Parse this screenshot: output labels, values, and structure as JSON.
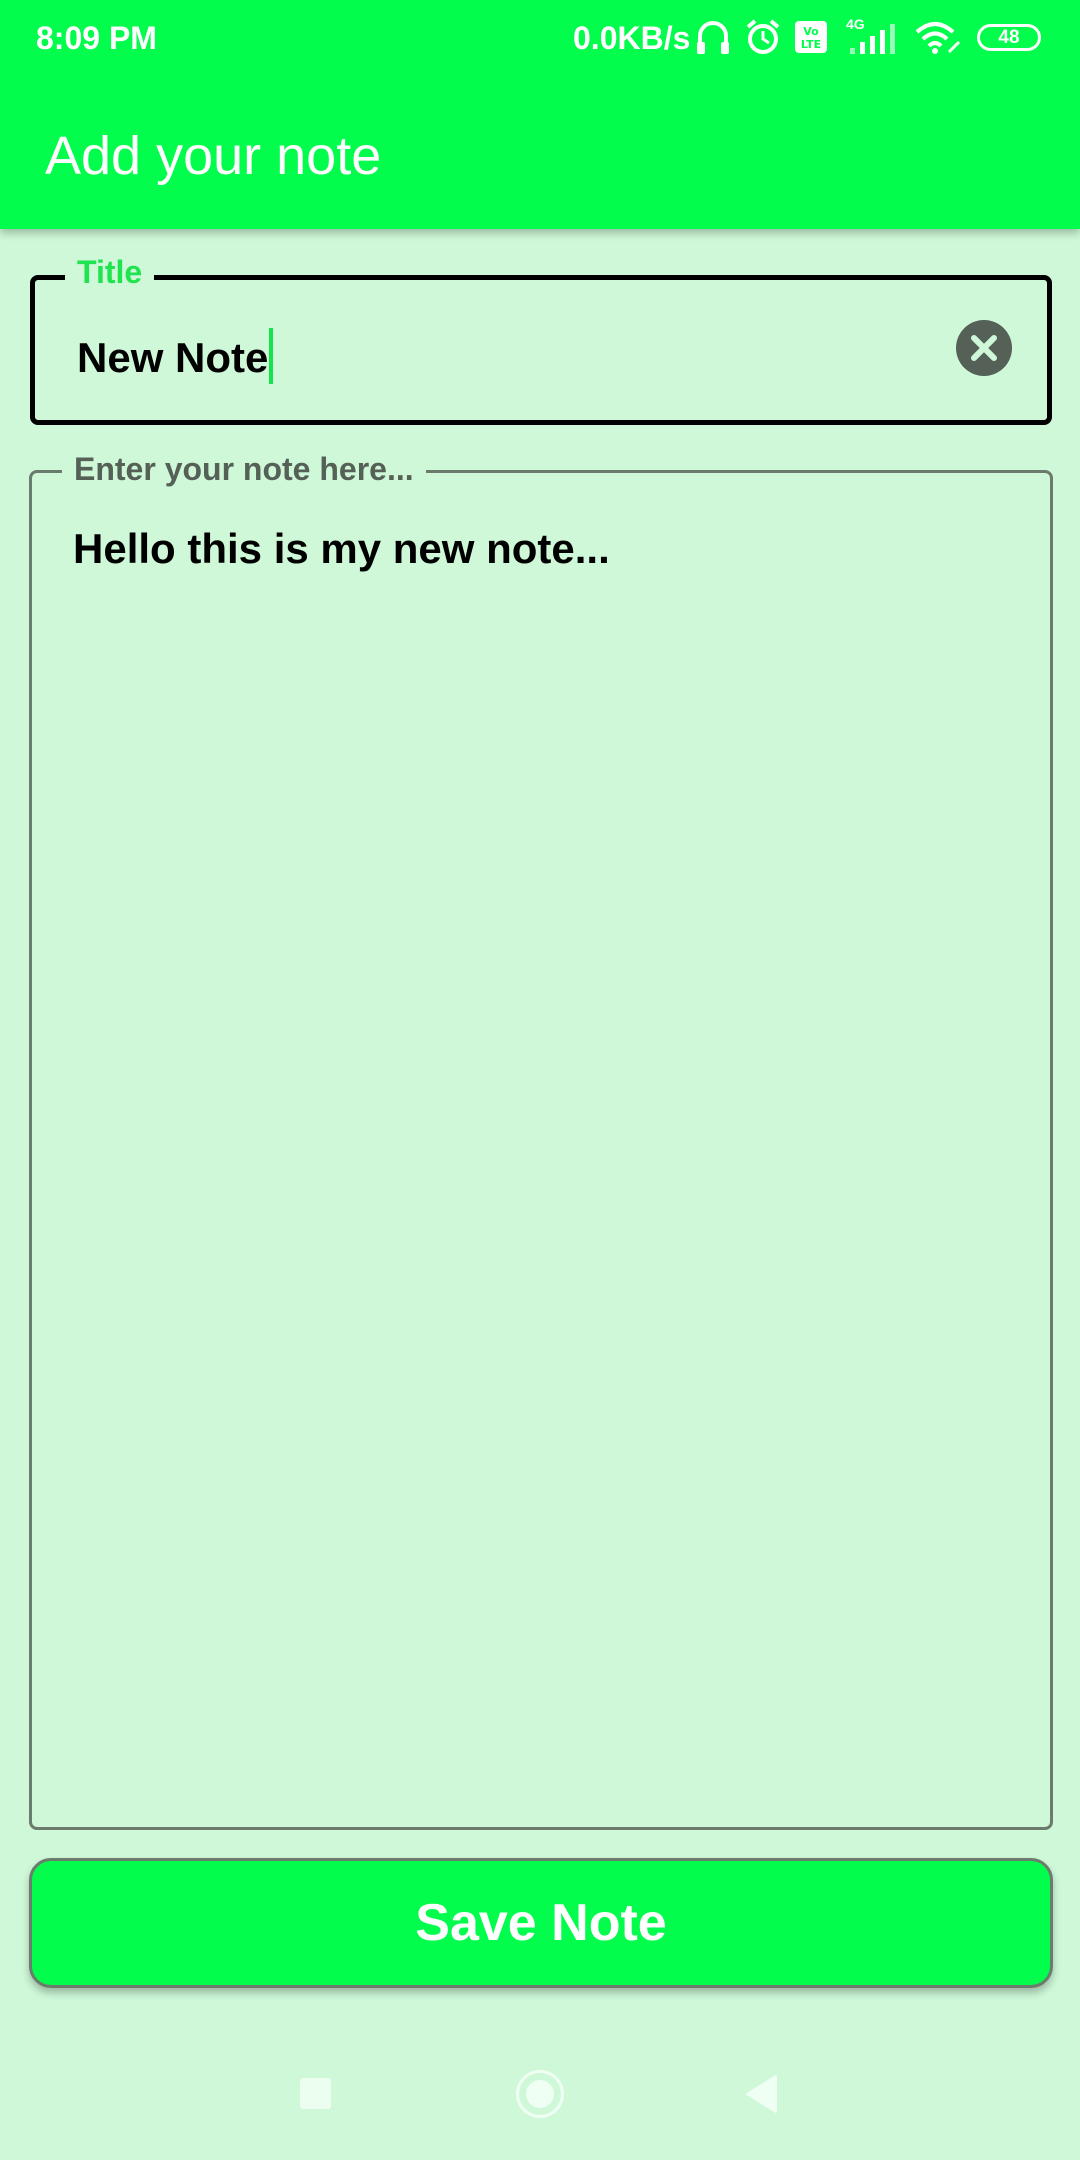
{
  "status_bar": {
    "time": "8:09 PM",
    "network_speed": "0.0KB/s",
    "network_type": "4G",
    "volte": "Vo LTE",
    "battery": "48",
    "icons": [
      "headset-icon",
      "alarm-icon",
      "volte-icon",
      "signal-icon",
      "wifi-icon",
      "battery-icon"
    ]
  },
  "app_bar": {
    "title": "Add your note"
  },
  "title_field": {
    "label": "Title",
    "value": "New Note"
  },
  "note_field": {
    "label": "Enter your note here...",
    "value": "Hello this is my new note..."
  },
  "save_button": {
    "label": "Save Note"
  },
  "colors": {
    "accent": "#02fd4c",
    "background": "#cef8d8",
    "caret": "#16e24b",
    "clear_button": "#556056"
  },
  "nav_bar": {
    "icons": [
      "recent-apps-icon",
      "home-icon",
      "back-icon"
    ]
  }
}
